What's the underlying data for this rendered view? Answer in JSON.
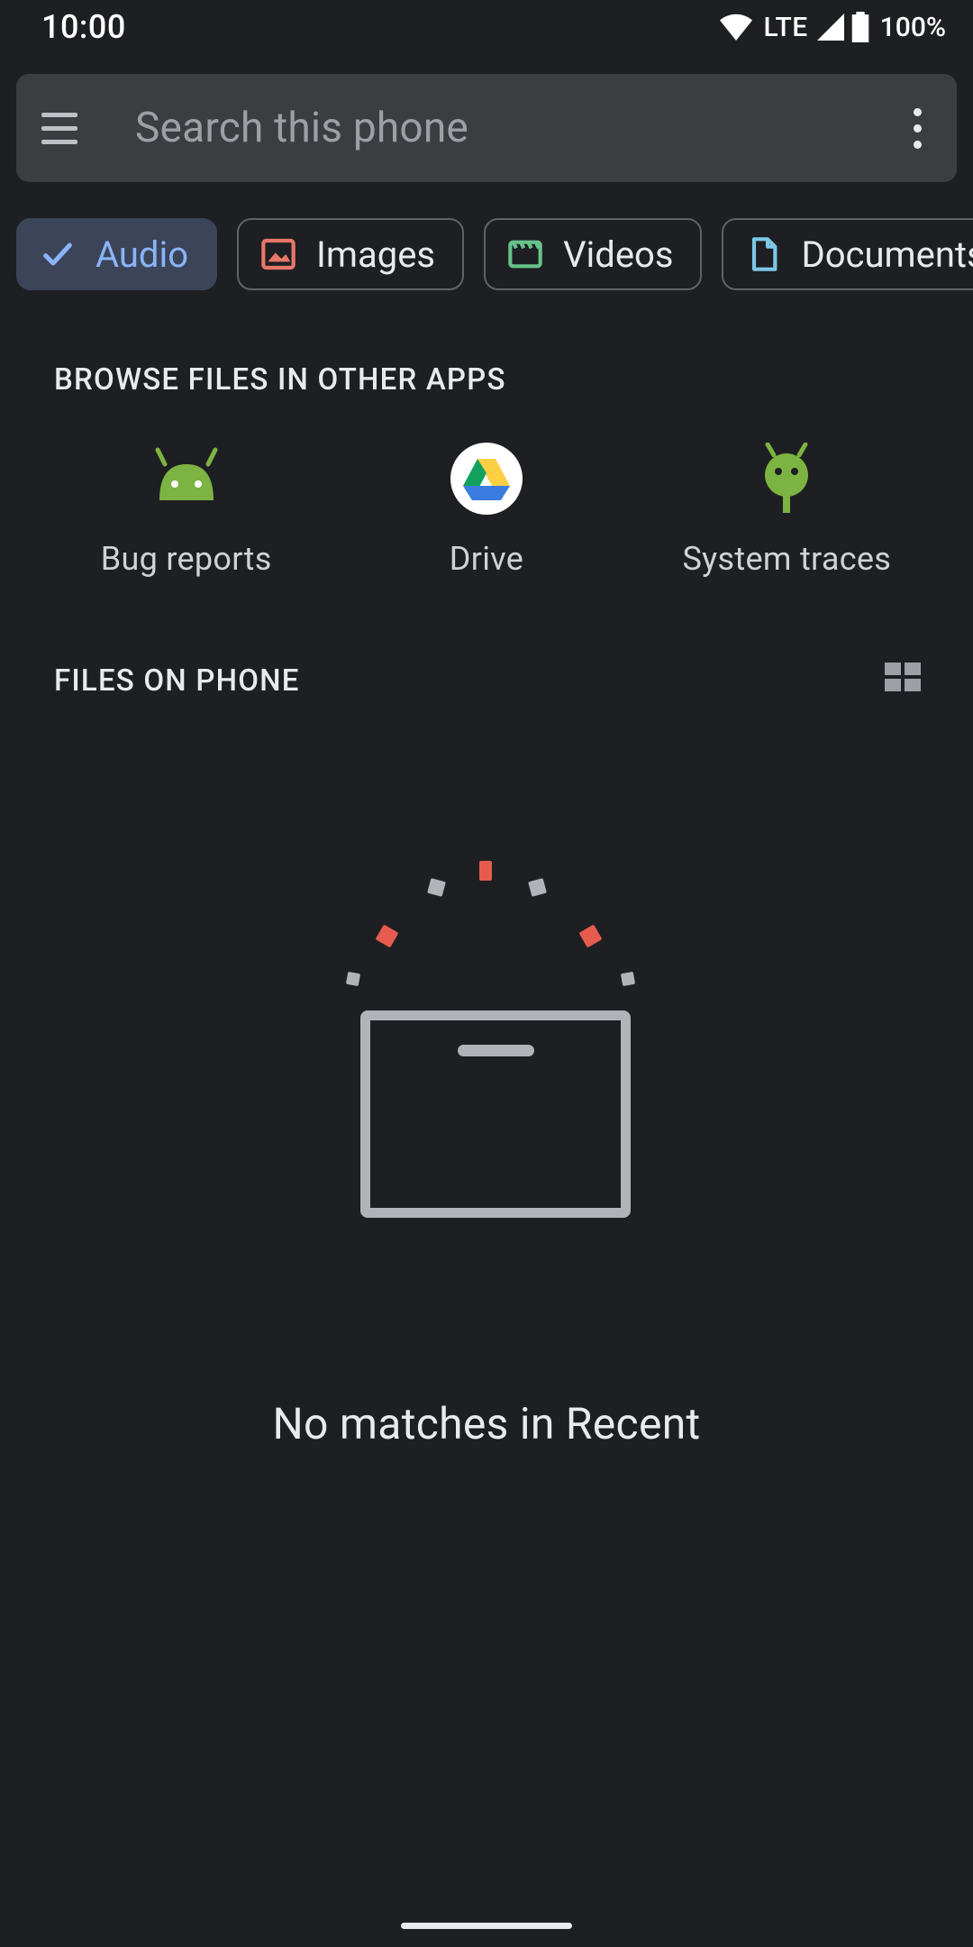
{
  "status": {
    "time": "10:00",
    "network": "LTE",
    "battery": "100%"
  },
  "search": {
    "placeholder": "Search this phone"
  },
  "chips": [
    {
      "label": "Audio",
      "selected": true
    },
    {
      "label": "Images",
      "selected": false
    },
    {
      "label": "Videos",
      "selected": false
    },
    {
      "label": "Documents",
      "selected": false
    }
  ],
  "sections": {
    "browse_other": "BROWSE FILES IN OTHER APPS",
    "files_on_phone": "FILES ON PHONE"
  },
  "other_apps": [
    {
      "label": "Bug reports"
    },
    {
      "label": "Drive"
    },
    {
      "label": "System traces"
    }
  ],
  "empty": {
    "message": "No matches in Recent"
  }
}
